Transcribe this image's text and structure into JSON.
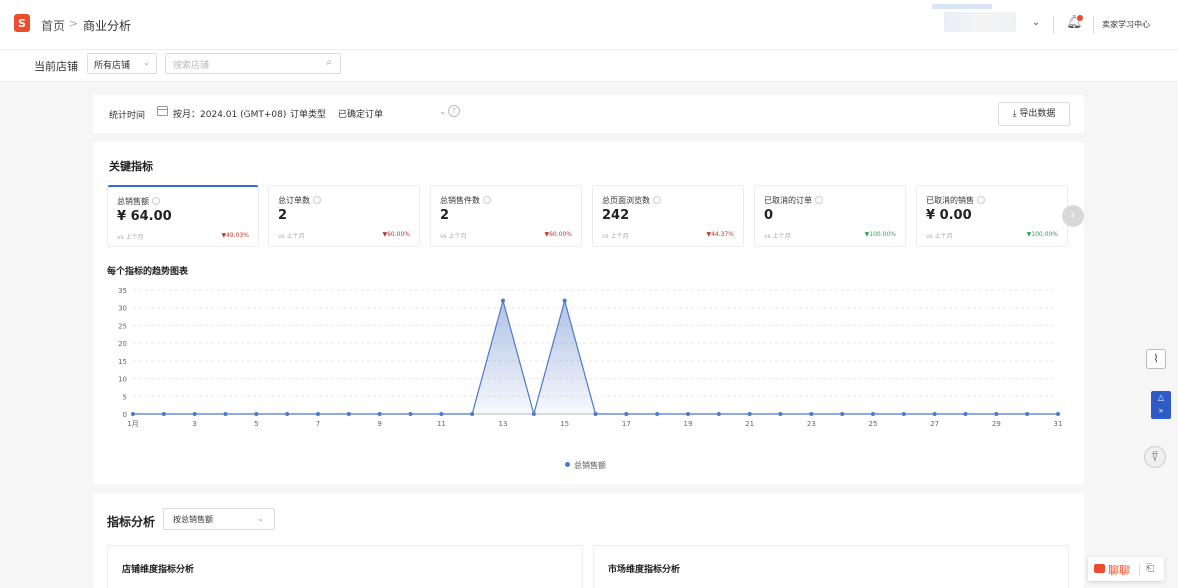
{
  "header": {
    "logo_text": "S",
    "breadcrumb_home": "首页",
    "breadcrumb_sep": ">",
    "breadcrumb_current": "商业分析",
    "account_chevron": "⌄",
    "seller_center": "卖家学习中心"
  },
  "filter": {
    "shop_label": "当前店铺",
    "shop_value": "所有店铺",
    "search_placeholder": "搜索店铺"
  },
  "timebar": {
    "label": "统计时间",
    "month_value": "按月：2024.01 (GMT+08)",
    "order_type_label": "订单类型",
    "order_type_value": "已确定订单",
    "export_label": "导出数据"
  },
  "key_metrics": {
    "title": "关键指标",
    "vs_text": "vs 上个月",
    "tiles": [
      {
        "name": "总销售额",
        "value": "¥ 64.00",
        "change": "49.03%",
        "dir": "down"
      },
      {
        "name": "总订单数",
        "value": "2",
        "change": "60.00%",
        "dir": "down"
      },
      {
        "name": "总销售件数",
        "value": "2",
        "change": "60.00%",
        "dir": "down"
      },
      {
        "name": "总页面浏览数",
        "value": "242",
        "change": "44.37%",
        "dir": "down"
      },
      {
        "name": "已取消的订单",
        "value": "0",
        "change": "100.00%",
        "dir": "up"
      },
      {
        "name": "已取消的销售",
        "value": "¥ 0.00",
        "change": "100.00%",
        "dir": "up"
      }
    ]
  },
  "trend": {
    "title": "每个指标的趋势图表",
    "legend": "总销售额"
  },
  "chart_data": {
    "type": "area",
    "title": "每个指标的趋势图表",
    "x": [
      1,
      2,
      3,
      4,
      5,
      6,
      7,
      8,
      9,
      10,
      11,
      12,
      13,
      14,
      15,
      16,
      17,
      18,
      19,
      20,
      21,
      22,
      23,
      24,
      25,
      26,
      27,
      28,
      29,
      30,
      31
    ],
    "x_tick_labels": [
      "1月",
      "3",
      "5",
      "7",
      "9",
      "11",
      "13",
      "15",
      "17",
      "19",
      "21",
      "23",
      "25",
      "27",
      "29",
      "31"
    ],
    "series": [
      {
        "name": "总销售额",
        "values": [
          0,
          0,
          0,
          0,
          0,
          0,
          0,
          0,
          0,
          0,
          0,
          0,
          32,
          0,
          32,
          0,
          0,
          0,
          0,
          0,
          0,
          0,
          0,
          0,
          0,
          0,
          0,
          0,
          0,
          0,
          0
        ]
      }
    ],
    "ylim": [
      0,
      35
    ],
    "y_ticks": [
      0,
      5,
      10,
      15,
      20,
      25,
      30,
      35
    ],
    "grid": true,
    "legend_position": "bottom-center",
    "color": "#4f78c6"
  },
  "analysis": {
    "title": "指标分析",
    "select_value": "按总销售额",
    "shop_dim": "店铺维度指标分析",
    "market_dim": "市场维度指标分析"
  },
  "chat": {
    "label": "聊聊"
  }
}
